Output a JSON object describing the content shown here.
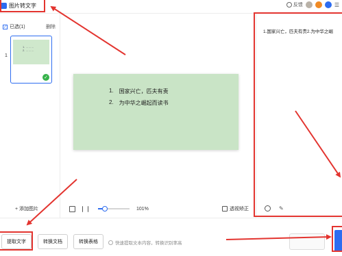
{
  "app": {
    "title": "图片转文字"
  },
  "header": {
    "feedback": "反馈"
  },
  "left": {
    "selected_label": "已选(1)",
    "delete_label": "删除",
    "thumb_index": "1",
    "add_label": "+ 添加图片"
  },
  "doc": {
    "lines": [
      {
        "num": "1.",
        "text": "国家兴亡，匹夫有责"
      },
      {
        "num": "2.",
        "text": "为中华之崛起而读书"
      }
    ]
  },
  "toolbar": {
    "zoom": "101%",
    "perspective_label": "透视矫正",
    "zoom_level": 0.22
  },
  "result": {
    "text": "1.国家兴亡，匹夫有责2.为中华之崛"
  },
  "bottom": {
    "extract_label": "提取文字",
    "convert_doc_label": "转换文档",
    "convert_table_label": "转换表格",
    "hint_text": "快速提取文本内容，转换识别率高",
    "gray_label": ""
  },
  "colors": {
    "accent": "#2d6cf0",
    "highlight": "#e3342f",
    "doc_bg": "#c9e4c6"
  }
}
